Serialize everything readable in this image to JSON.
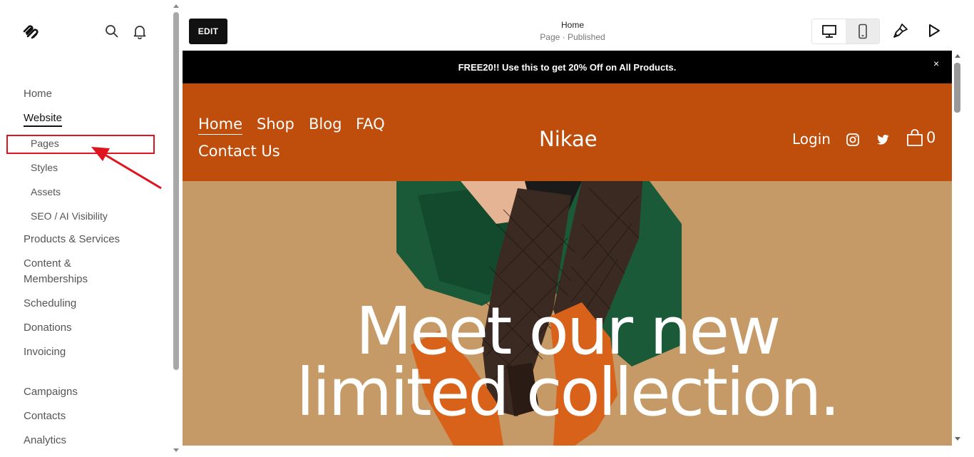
{
  "sidebar": {
    "logo": "squarespace-logo",
    "items": [
      {
        "label": "Home"
      },
      {
        "label": "Website"
      },
      {
        "label": "Pages"
      },
      {
        "label": "Styles"
      },
      {
        "label": "Assets"
      },
      {
        "label": "SEO / AI Visibility"
      },
      {
        "label": "Products & Services"
      },
      {
        "label": "Content &"
      },
      {
        "label": "Memberships"
      },
      {
        "label": "Scheduling"
      },
      {
        "label": "Donations"
      },
      {
        "label": "Invoicing"
      },
      {
        "label": "Campaigns"
      },
      {
        "label": "Contacts"
      },
      {
        "label": "Analytics"
      }
    ],
    "active": "Website",
    "highlighted": "Pages"
  },
  "toolbar": {
    "edit_label": "EDIT",
    "page_title": "Home",
    "page_status": "Page · Published",
    "device_selected": "mobile"
  },
  "site": {
    "banner_text": "FREE20!! Use this to get 20% Off on All Products.",
    "banner_close": "×",
    "nav": [
      {
        "label": "Home"
      },
      {
        "label": "Shop"
      },
      {
        "label": "Blog"
      },
      {
        "label": "FAQ"
      },
      {
        "label": "Contact Us"
      }
    ],
    "brand": "Nikae",
    "login_label": "Login",
    "cart_count": "0",
    "hero_line1": "Meet our new",
    "hero_line2": "limited collection."
  },
  "colors": {
    "header_bg": "#bf4d0c",
    "banner_bg": "#000000",
    "hero_bg": "#c59a66",
    "annotation": "#e0141e"
  }
}
